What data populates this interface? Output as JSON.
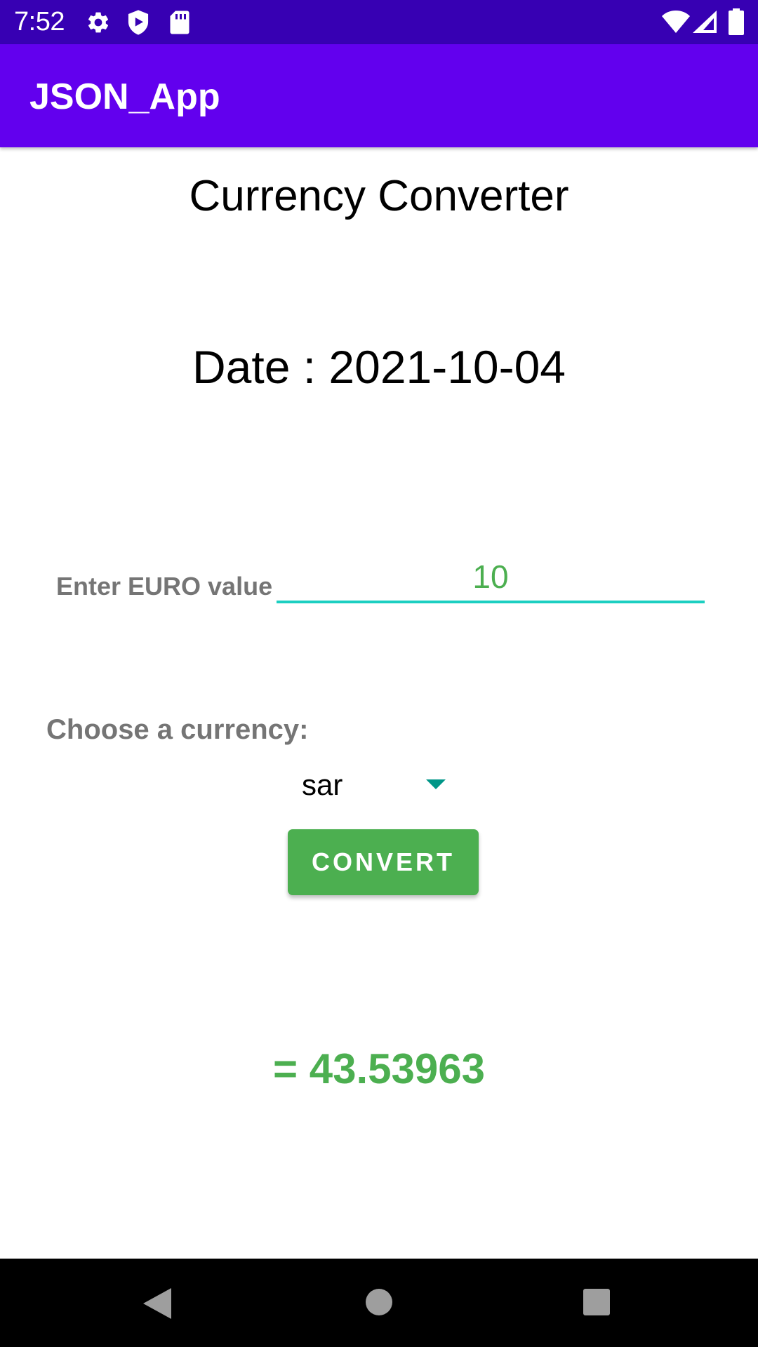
{
  "status_bar": {
    "time": "7:52",
    "icons_left": [
      "gear-icon",
      "shield-icon",
      "sd-card-icon"
    ],
    "icons_right": [
      "wifi-icon",
      "signal-icon",
      "battery-icon"
    ],
    "background": "#3700b3"
  },
  "app_bar": {
    "title": "JSON_App",
    "background": "#6200ee"
  },
  "main": {
    "title": "Currency Converter",
    "date_text": "Date : 2021-10-04",
    "euro_label": "Enter EURO value",
    "euro_value": "10",
    "currency_label": "Choose a currency:",
    "selected_currency": "sar",
    "convert_label": "CONVERT",
    "result_text": "= 43.53963"
  },
  "colors": {
    "accent_green": "#4caf50",
    "input_underline": "#1ccfc1",
    "spinner_arrow": "#009688"
  },
  "nav_bar": {
    "buttons": [
      "back-icon",
      "home-icon",
      "recents-icon"
    ]
  }
}
